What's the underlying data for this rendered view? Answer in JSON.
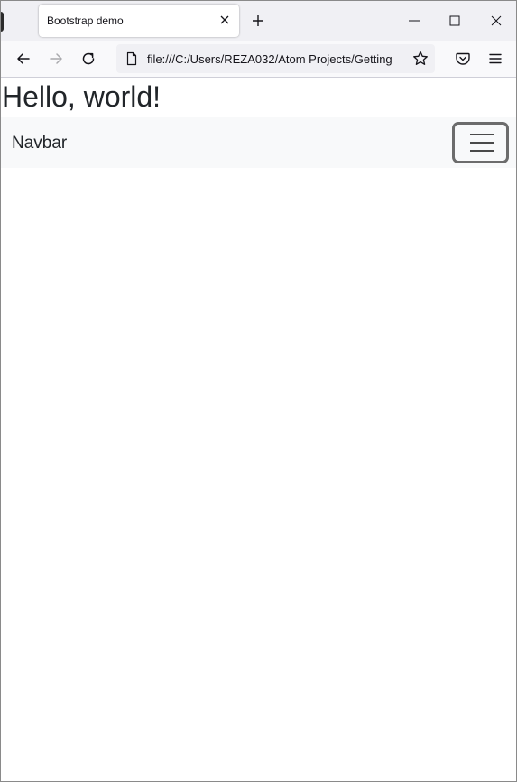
{
  "browser": {
    "tab": {
      "title": "Bootstrap demo",
      "close_icon": "close-icon"
    },
    "new_tab_icon": "plus-icon",
    "window_controls": {
      "minimize_icon": "minimize-icon",
      "maximize_icon": "maximize-icon",
      "close_icon": "close-icon"
    },
    "toolbar": {
      "back_icon": "arrow-left-icon",
      "forward_icon": "arrow-right-icon",
      "reload_icon": "reload-icon",
      "url": "file:///C:/Users/REZA032/Atom Projects/Getting",
      "page_icon": "file-icon",
      "bookmark_icon": "star-icon",
      "pocket_icon": "pocket-icon",
      "menu_icon": "hamburger-menu-icon"
    }
  },
  "page": {
    "heading": "Hello, world!",
    "navbar": {
      "brand": "Navbar",
      "toggler_icon": "hamburger-menu-icon",
      "background": "#f8f9fa"
    }
  }
}
